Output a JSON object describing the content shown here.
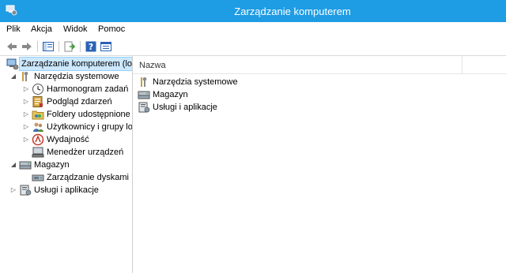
{
  "window": {
    "title": "Zarządzanie komputerem",
    "accent": "#1e9ce4"
  },
  "menu": [
    {
      "label": "Plik"
    },
    {
      "label": "Akcja"
    },
    {
      "label": "Widok"
    },
    {
      "label": "Pomoc"
    }
  ],
  "toolbar": {
    "buttons": [
      {
        "icon": "back-arrow-icon"
      },
      {
        "icon": "forward-arrow-icon"
      },
      {
        "icon": "show-hide-console-tree-icon"
      },
      {
        "icon": "export-list-icon"
      },
      {
        "icon": "help-icon"
      },
      {
        "icon": "properties-icon"
      }
    ]
  },
  "tree": {
    "root": {
      "label": "Zarządzanie komputerem (lokalne)",
      "icon": "computer-management-icon"
    },
    "system_tools": {
      "label": "Narzędzia systemowe",
      "icon": "tools-icon"
    },
    "task_scheduler": {
      "label": "Harmonogram zadań",
      "icon": "clock-icon"
    },
    "event_viewer": {
      "label": "Podgląd zdarzeń",
      "icon": "event-viewer-icon"
    },
    "shared_folders": {
      "label": "Foldery udostępnione",
      "icon": "shared-folder-icon"
    },
    "users_groups": {
      "label": "Użytkownicy i grupy lokalne",
      "icon": "users-icon"
    },
    "performance": {
      "label": "Wydajność",
      "icon": "performance-icon"
    },
    "device_manager": {
      "label": "Menedżer urządzeń",
      "icon": "device-manager-icon"
    },
    "storage": {
      "label": "Magazyn",
      "icon": "storage-icon"
    },
    "disk_management": {
      "label": "Zarządzanie dyskami",
      "icon": "disk-icon"
    },
    "services_apps": {
      "label": "Usługi i aplikacje",
      "icon": "services-icon"
    }
  },
  "list": {
    "column_name": "Nazwa",
    "items": [
      {
        "label": "Narzędzia systemowe",
        "icon": "tools-icon"
      },
      {
        "label": "Magazyn",
        "icon": "storage-icon"
      },
      {
        "label": "Usługi i aplikacje",
        "icon": "services-icon"
      }
    ]
  }
}
